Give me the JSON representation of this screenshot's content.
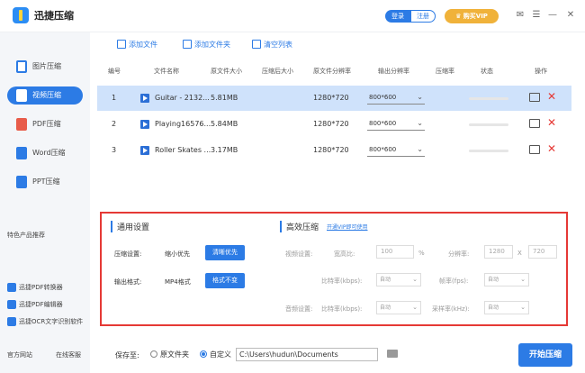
{
  "app": {
    "title": "迅捷压缩"
  },
  "titlebar": {
    "login": "登录",
    "register": "注册",
    "vip": "购买VIP"
  },
  "sidebar": {
    "items": [
      {
        "label": "图片压缩"
      },
      {
        "label": "视频压缩"
      },
      {
        "label": "PDF压缩"
      },
      {
        "label": "Word压缩"
      },
      {
        "label": "PPT压缩"
      }
    ],
    "recommend_title": "特色产品推荐",
    "recommend": [
      {
        "label": "迅捷PDF转换器"
      },
      {
        "label": "迅捷PDF编辑器"
      },
      {
        "label": "迅捷OCR文字识别软件"
      }
    ],
    "official_site": "官方网站",
    "online_support": "在线客服"
  },
  "toolbar": {
    "add_file": "添加文件",
    "add_folder": "添加文件夹",
    "clear_list": "清空列表"
  },
  "table": {
    "headers": [
      "编号",
      "文件名称",
      "原文件大小",
      "压缩后大小",
      "原文件分辨率",
      "输出分辨率",
      "压缩率",
      "状态",
      "操作"
    ],
    "rows": [
      {
        "num": "1",
        "name": "Guitar - 2132...",
        "size": "5.81MB",
        "compressed": "",
        "resolution": "1280*720",
        "output": "800*600",
        "rate": ""
      },
      {
        "num": "2",
        "name": "Playing16576...",
        "size": "5.84MB",
        "compressed": "",
        "resolution": "1280*720",
        "output": "800*600",
        "rate": ""
      },
      {
        "num": "3",
        "name": "Roller Skates ...",
        "size": "3.17MB",
        "compressed": "",
        "resolution": "1280*720",
        "output": "800*600",
        "rate": ""
      }
    ]
  },
  "settings": {
    "general_title": "通用设置",
    "compress_label": "压缩设置:",
    "compress_option": "缩小优先",
    "compress_button": "清晰优先",
    "format_label": "输出格式:",
    "format_value": "MP4格式",
    "format_button": "格式不变",
    "advanced_title": "高效压缩",
    "vip_link": "开通VIP即可使用",
    "video_settings": "视频设置:",
    "aspect_label": "宽高比:",
    "aspect_value": "100",
    "percent": "%",
    "resolution_label": "分辨率:",
    "width": "1280",
    "x_sep": "X",
    "height": "720",
    "bitrate_label": "比特率(kbps):",
    "bitrate_value": "自动",
    "fps_label": "帧率(fps):",
    "fps_value": "自动",
    "audio_settings": "音频设置:",
    "audio_bitrate_label": "比特率(kbps):",
    "audio_bitrate_value": "自动",
    "sample_label": "采样率(kHz):",
    "sample_value": "自动"
  },
  "bottom": {
    "save_to": "保存至:",
    "option_original": "原文件夹",
    "option_custom": "自定义",
    "path": "C:\\Users\\hudun\\Documents",
    "start": "开始压缩"
  }
}
